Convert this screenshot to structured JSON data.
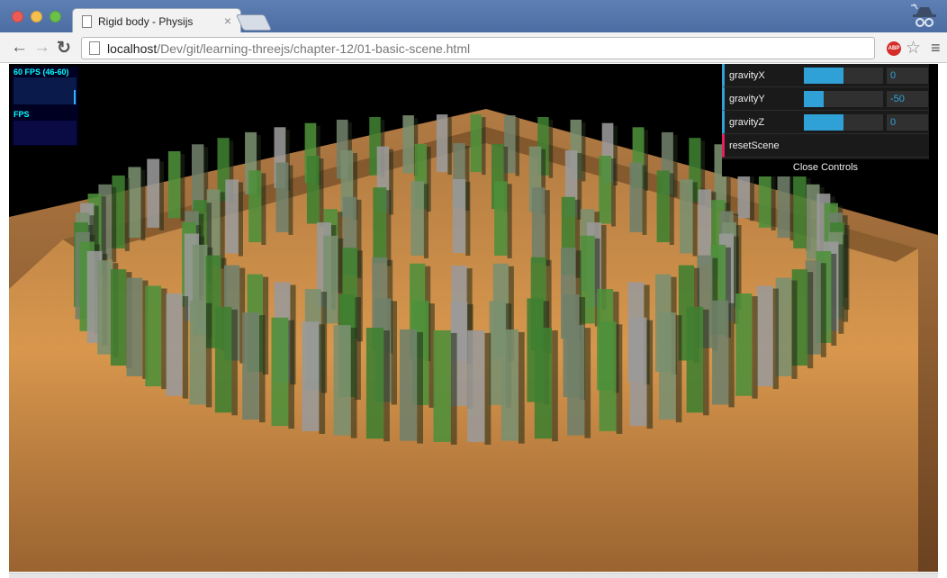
{
  "browser": {
    "tab_title": "Rigid body - Physijs",
    "tab_close": "×",
    "url_host": "localhost",
    "url_path": "/Dev/git/learning-threejs/chapter-12/01-basic-scene.html",
    "icons": {
      "back": "arrow-left-icon",
      "forward": "arrow-right-icon",
      "reload": "reload-icon",
      "page": "page-icon",
      "adblock": "adblock-icon",
      "bookmark": "star-icon",
      "menu": "hamburger-menu-icon",
      "incognito": "incognito-icon"
    },
    "adblock_text": "ABP"
  },
  "stats": {
    "fps_label": "60 FPS (46-60)",
    "ms_label": "FPS"
  },
  "gui": {
    "rows": [
      {
        "label": "gravityX",
        "value": "0",
        "level": 0.5
      },
      {
        "label": "gravityY",
        "value": "-50",
        "level": 0.25
      },
      {
        "label": "gravityZ",
        "value": "0",
        "level": 0.5
      }
    ],
    "reset_label": "resetScene",
    "close_label": "Close Controls",
    "accent": "#2fa1d6",
    "function_accent": "#e61d5f"
  },
  "scene": {
    "floor_color": "#c88a45",
    "wall_color": "#8a5a2a",
    "block_colors": [
      "#3f7f30",
      "#7a8f70",
      "#9a9a9a",
      "#4d8f3a",
      "#6f7f6a"
    ]
  }
}
